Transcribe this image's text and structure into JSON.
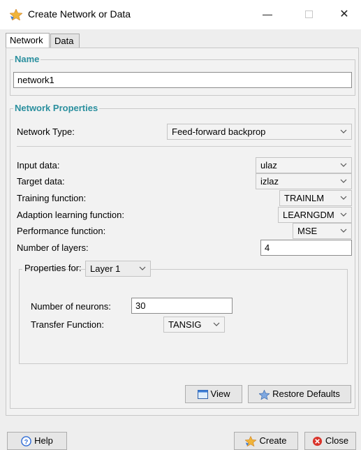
{
  "window": {
    "title": "Create Network or Data",
    "minimize_glyph": "—",
    "maximize_glyph": "☐",
    "close_glyph": "✕"
  },
  "tabs": [
    {
      "label": "Network",
      "active": true
    },
    {
      "label": "Data",
      "active": false
    }
  ],
  "name_group": {
    "title": "Name",
    "value": "network1"
  },
  "props_group": {
    "title": "Network Properties",
    "network_type": {
      "label": "Network Type:",
      "value": "Feed-forward backprop"
    },
    "input_data": {
      "label": "Input data:",
      "value": "ulaz"
    },
    "target_data": {
      "label": "Target data:",
      "value": "izlaz"
    },
    "training_function": {
      "label": "Training function:",
      "value": "TRAINLM"
    },
    "adaption_function": {
      "label": "Adaption learning function:",
      "value": "LEARNGDM"
    },
    "performance_function": {
      "label": "Performance function:",
      "value": "MSE"
    },
    "num_layers": {
      "label": "Number of layers:",
      "value": "4"
    }
  },
  "layer_group": {
    "label": "Properties for:",
    "layer_value": "Layer 1",
    "neurons": {
      "label": "Number of neurons:",
      "value": "30"
    },
    "transfer": {
      "label": "Transfer Function:",
      "value": "TANSIG"
    }
  },
  "buttons": {
    "view": "View",
    "restore": "Restore Defaults",
    "help": "Help",
    "create": "Create",
    "close": "Close"
  },
  "icons": {
    "app": "matlab-star-icon",
    "view": "window-icon",
    "restore": "star-icon",
    "help": "help-icon",
    "create": "star-icon",
    "close": "close-circle-icon"
  },
  "colors": {
    "group_title": "#2a8f9e",
    "close_icon": "#d9342b",
    "help_icon": "#2d6bd6"
  }
}
